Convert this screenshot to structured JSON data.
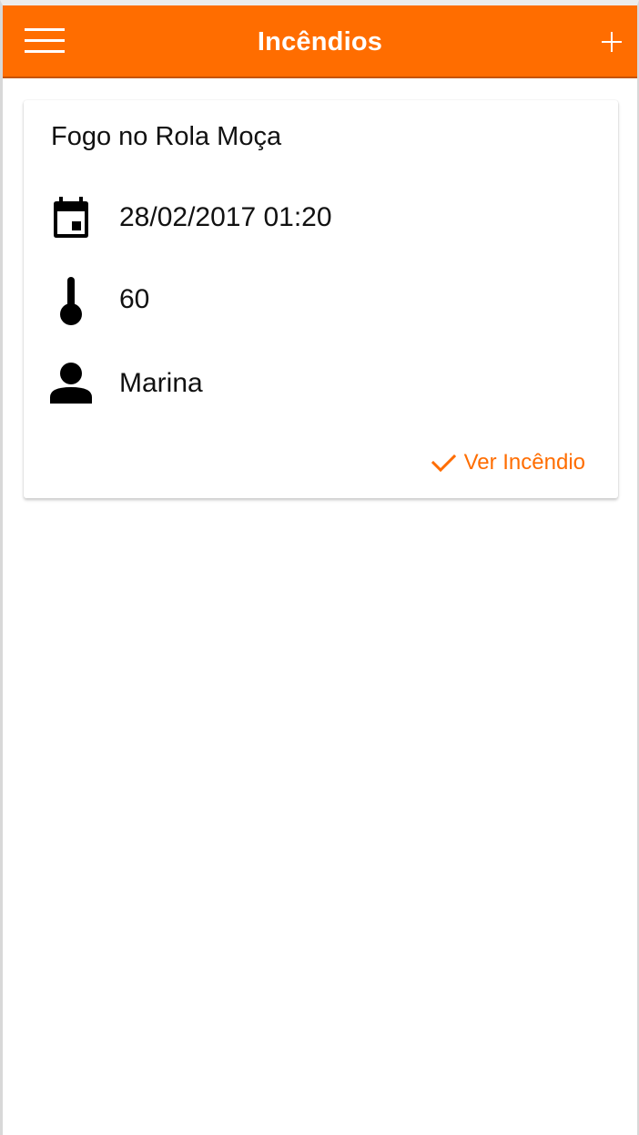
{
  "header": {
    "title": "Incêndios",
    "menu_icon": "hamburger-menu-icon",
    "add_icon": "plus-icon"
  },
  "colors": {
    "accent": "#ff6d00",
    "accent_dark": "#c65400",
    "text": "#111111",
    "background": "#ffffff"
  },
  "incidents": [
    {
      "title": "Fogo no Rola Moça",
      "datetime": "28/02/2017 01:20",
      "temperature": "60",
      "reporter": "Marina",
      "action_label": "Ver Incêndio",
      "icons": {
        "datetime": "calendar-icon",
        "temperature": "thermometer-icon",
        "reporter": "person-icon",
        "action": "check-icon"
      }
    }
  ]
}
